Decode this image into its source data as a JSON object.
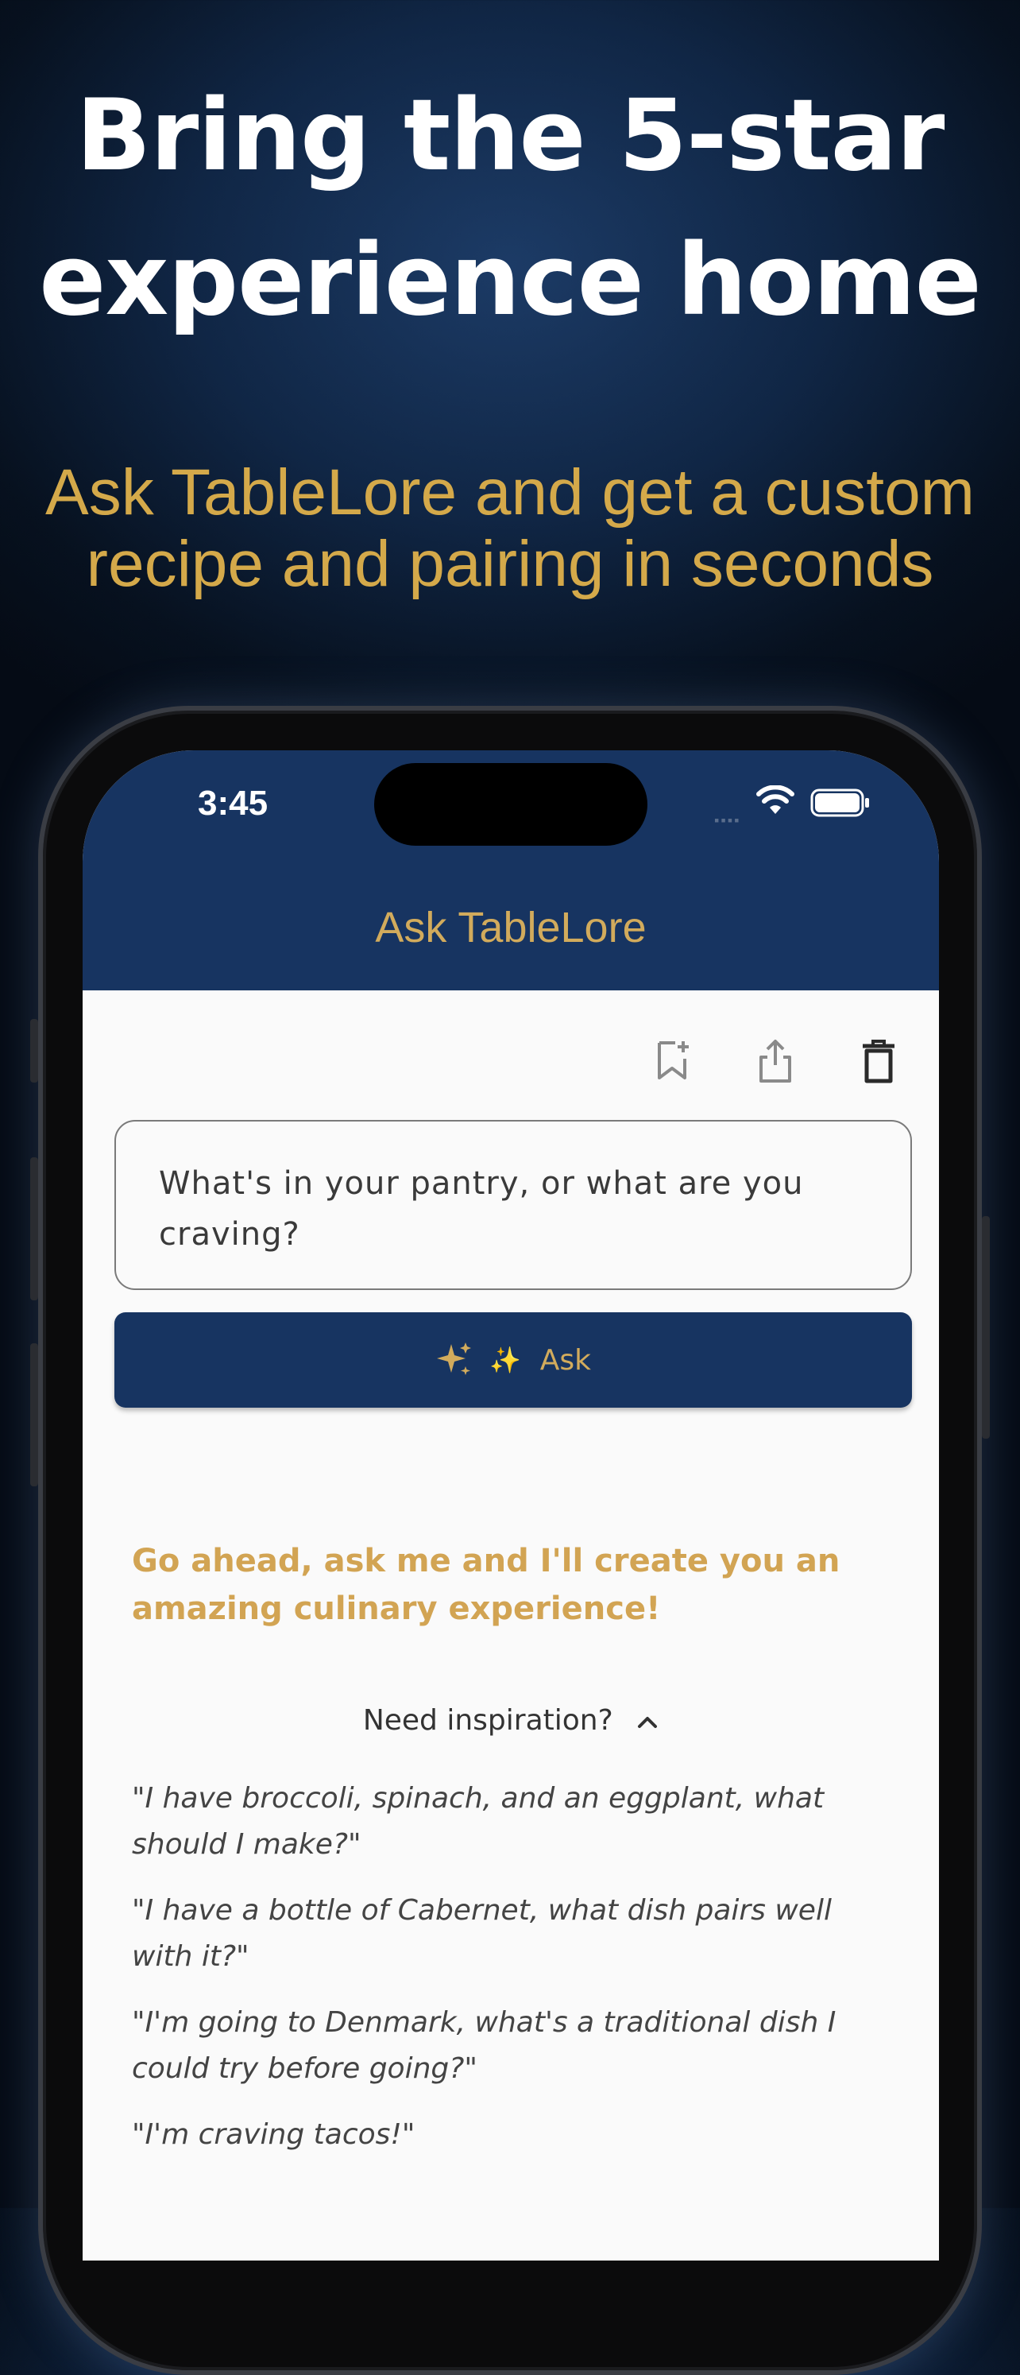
{
  "hero": {
    "headline_line1": "Bring the 5-star",
    "headline_line2": "experience home",
    "subhead_line1": "Ask TableLore and get a custom",
    "subhead_line2": "recipe and pairing in seconds"
  },
  "status_bar": {
    "time": "3:45",
    "icons": [
      "signal-icon",
      "wifi-icon",
      "battery-icon"
    ]
  },
  "app": {
    "title": "Ask TableLore",
    "toolbar_icons": [
      "bookmark-add-icon",
      "share-icon",
      "trash-icon"
    ],
    "prompt_placeholder": "What's in your pantry, or what are you craving?",
    "ask_button": {
      "sparkle": "✦",
      "mini_sparkle": "✨",
      "label": "Ask"
    },
    "intro": "Go ahead, ask me and I'll create you an amazing culinary experience!",
    "inspiration_label": "Need inspiration?",
    "examples": [
      "\"I have broccoli, spinach, and an eggplant, what should I make?\"",
      "\"I have a bottle of Cabernet, what dish pairs well with it?\"",
      "\"I'm going to Denmark, what's a traditional dish I could try before going?\"",
      "\"I'm craving tacos!\""
    ]
  },
  "colors": {
    "navy": "#173461",
    "gold": "#d2ab5c",
    "background_dark": "#07111f"
  }
}
